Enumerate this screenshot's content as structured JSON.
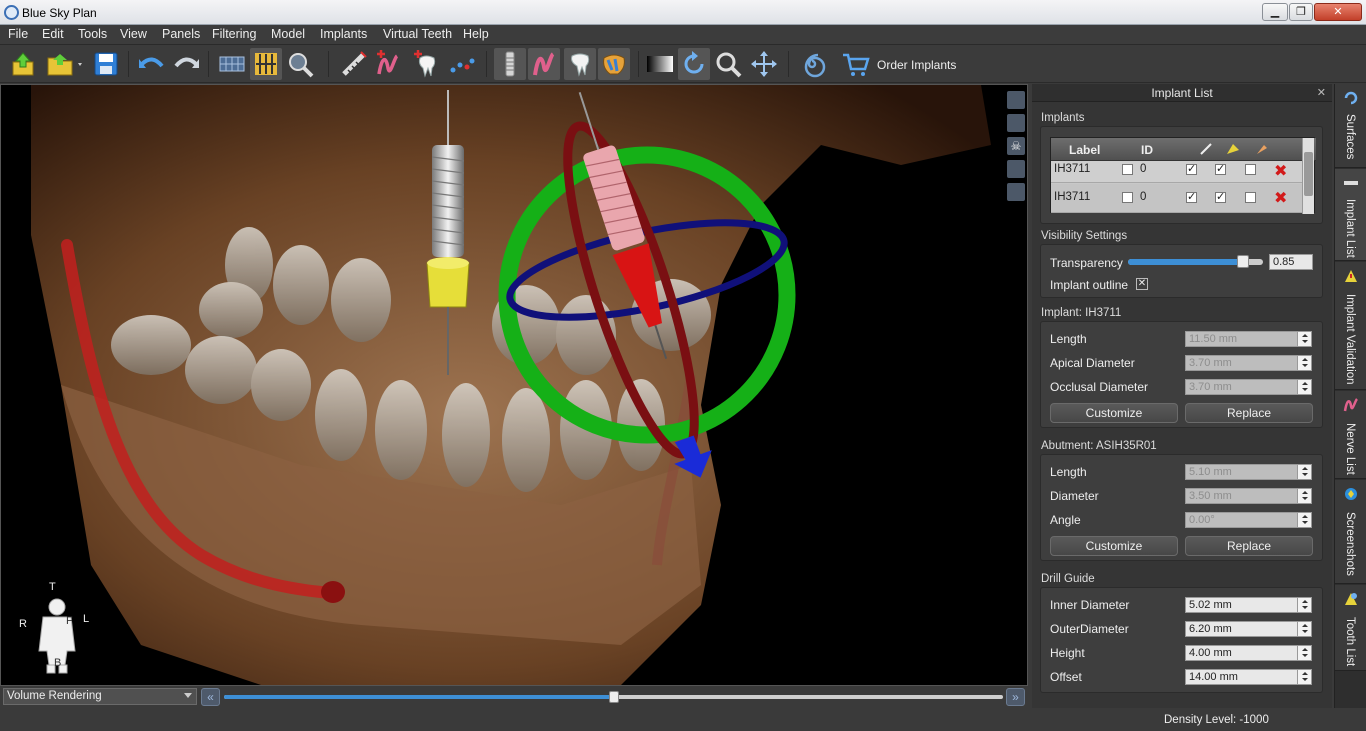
{
  "window": {
    "title": "Blue Sky Plan",
    "min_label": "▁",
    "max_label": "❐",
    "close_label": "✕"
  },
  "menu": [
    "File",
    "Edit",
    "Tools",
    "View",
    "Panels",
    "Filtering",
    "Model",
    "Implants",
    "Virtual Teeth",
    "Help"
  ],
  "toolbar": {
    "order_implants_label": "Order Implants"
  },
  "viewport": {
    "orientation": {
      "top": "T",
      "right": "R",
      "left": "L",
      "front": "F",
      "back": "B"
    },
    "render_mode": "Volume Rendering",
    "slider_value": 0.5
  },
  "status": {
    "density": "Density Level: -1000"
  },
  "panel": {
    "title": "Implant List",
    "close": "✕",
    "implants_title": "Implants",
    "table": {
      "headers": {
        "label": "Label",
        "id": "ID"
      },
      "rows": [
        {
          "label": "IH3711",
          "id": "0"
        },
        {
          "label": "IH3711",
          "id": "0"
        }
      ]
    },
    "visibility_title": "Visibility Settings",
    "transparency_label": "Transparency",
    "transparency_value": "0.85",
    "transparency_fraction": 0.85,
    "outline_label": "Implant outline",
    "implant_title": "Implant: IH3711",
    "implant": {
      "length_label": "Length",
      "length": "11.50 mm",
      "apical_label": "Apical Diameter",
      "apical": "3.70 mm",
      "occlusal_label": "Occlusal Diameter",
      "occlusal": "3.70 mm",
      "customize": "Customize",
      "replace": "Replace"
    },
    "abutment_title": "Abutment: ASIH35R01",
    "abutment": {
      "length_label": "Length",
      "length": "5.10 mm",
      "diameter_label": "Diameter",
      "diameter": "3.50 mm",
      "angle_label": "Angle",
      "angle": "0.00°",
      "customize": "Customize",
      "replace": "Replace"
    },
    "drill_title": "Drill Guide",
    "drill": {
      "inner_label": "Inner Diameter",
      "inner": "5.02 mm",
      "outer_label": "OuterDiameter",
      "outer": "6.20 mm",
      "height_label": "Height",
      "height": "4.00 mm",
      "offset_label": "Offset",
      "offset": "14.00 mm"
    }
  },
  "side_tabs": [
    "Surfaces",
    "Implant List",
    "Implant Validation",
    "Nerve List",
    "Screenshots",
    "Tooth List"
  ]
}
